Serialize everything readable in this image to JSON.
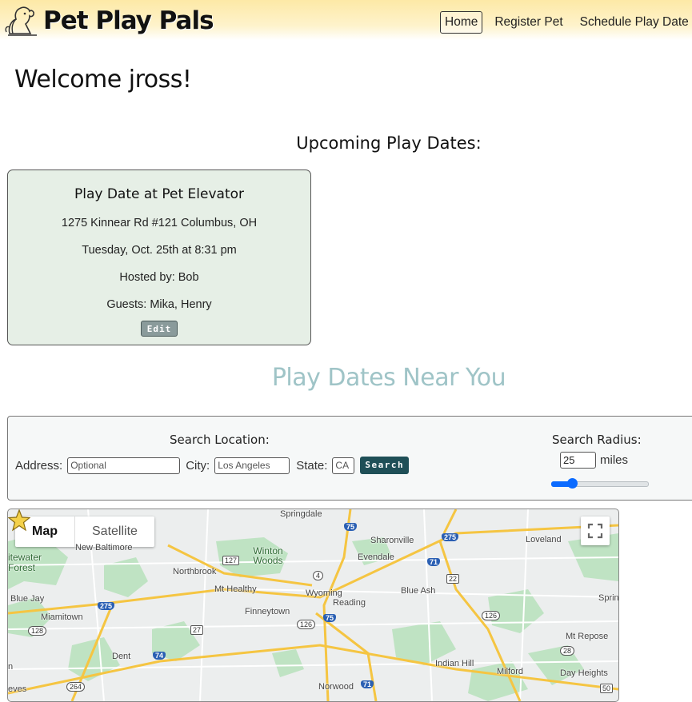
{
  "header": {
    "logo_text": "Pet Play Pals",
    "nav": [
      {
        "label": "Home",
        "active": true
      },
      {
        "label": "Register Pet",
        "active": false
      },
      {
        "label": "Schedule Play Date",
        "active": false
      }
    ]
  },
  "welcome": "Welcome jross!",
  "upcoming": {
    "title": "Upcoming Play Dates:",
    "card": {
      "title": "Play Date at Pet Elevator",
      "address": "1275 Kinnear Rd #121 Columbus, OH",
      "datetime": "Tuesday, Oct. 25th at 8:31 pm",
      "host": "Hosted by: Bob",
      "guests": "Guests: Mika, Henry",
      "edit_label": "Edit"
    }
  },
  "near": {
    "title": "Play Dates Near You"
  },
  "search": {
    "location_title": "Search Location:",
    "address_label": "Address:",
    "address_placeholder": "Optional",
    "city_label": "City:",
    "city_placeholder": "Los Angeles",
    "state_label": "State:",
    "state_placeholder": "CA",
    "search_label": "Search",
    "radius_title": "Search Radius:",
    "radius_value": "25",
    "radius_unit": "miles",
    "slider_fraction": 0.19
  },
  "map": {
    "map_tab": "Map",
    "satellite_tab": "Satellite",
    "places": [
      "Springdale",
      "Sharonville",
      "Loveland",
      "Evendale",
      "Winton Woods",
      "Northbrook",
      "Mt Healthy",
      "Wyoming",
      "Reading",
      "Blue Ash",
      "Finneytown",
      "Miamitown",
      "Dent",
      "Indian Hill",
      "Milford",
      "Mt Repose",
      "Day Heights",
      "Norwood",
      "New Baltimore",
      "itewater",
      "Forest",
      "Blue Jay",
      "Sprin",
      "eves",
      "n"
    ],
    "shields": [
      "75",
      "275",
      "127",
      "71",
      "4",
      "22",
      "275",
      "126",
      "27",
      "75",
      "126",
      "128",
      "74",
      "28",
      "264",
      "71",
      "50"
    ]
  },
  "colors": {
    "header": "#fde9a6",
    "card": "#e6efe6",
    "near_title": "#9fc4c7",
    "search_button": "#1f4f57",
    "slider": "#0b6bff"
  }
}
